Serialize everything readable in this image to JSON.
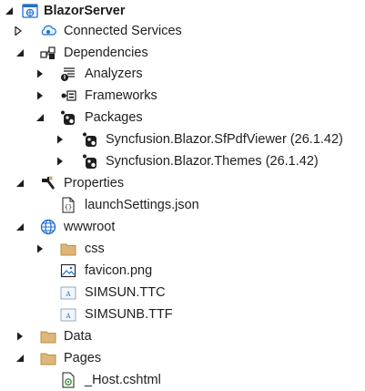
{
  "tree": {
    "project": "BlazorServer",
    "connected_services": "Connected Services",
    "dependencies": "Dependencies",
    "analyzers": "Analyzers",
    "frameworks": "Frameworks",
    "packages": "Packages",
    "package_items": [
      "Syncfusion.Blazor.SfPdfViewer (26.1.42)",
      "Syncfusion.Blazor.Themes (26.1.42)"
    ],
    "properties": "Properties",
    "launch_settings": "launchSettings.json",
    "wwwroot": "wwwroot",
    "css": "css",
    "favicon": "favicon.png",
    "simsun_ttc": "SIMSUN.TTC",
    "simsunb_ttf": "SIMSUNB.TTF",
    "data_folder": "Data",
    "pages_folder": "Pages",
    "host_file": "_Host.cshtml"
  },
  "colors": {
    "folder": "#dcb67a",
    "folder_dark": "#b8923f",
    "globe": "#1f6fd1",
    "arrow": "#1e1e1e"
  }
}
